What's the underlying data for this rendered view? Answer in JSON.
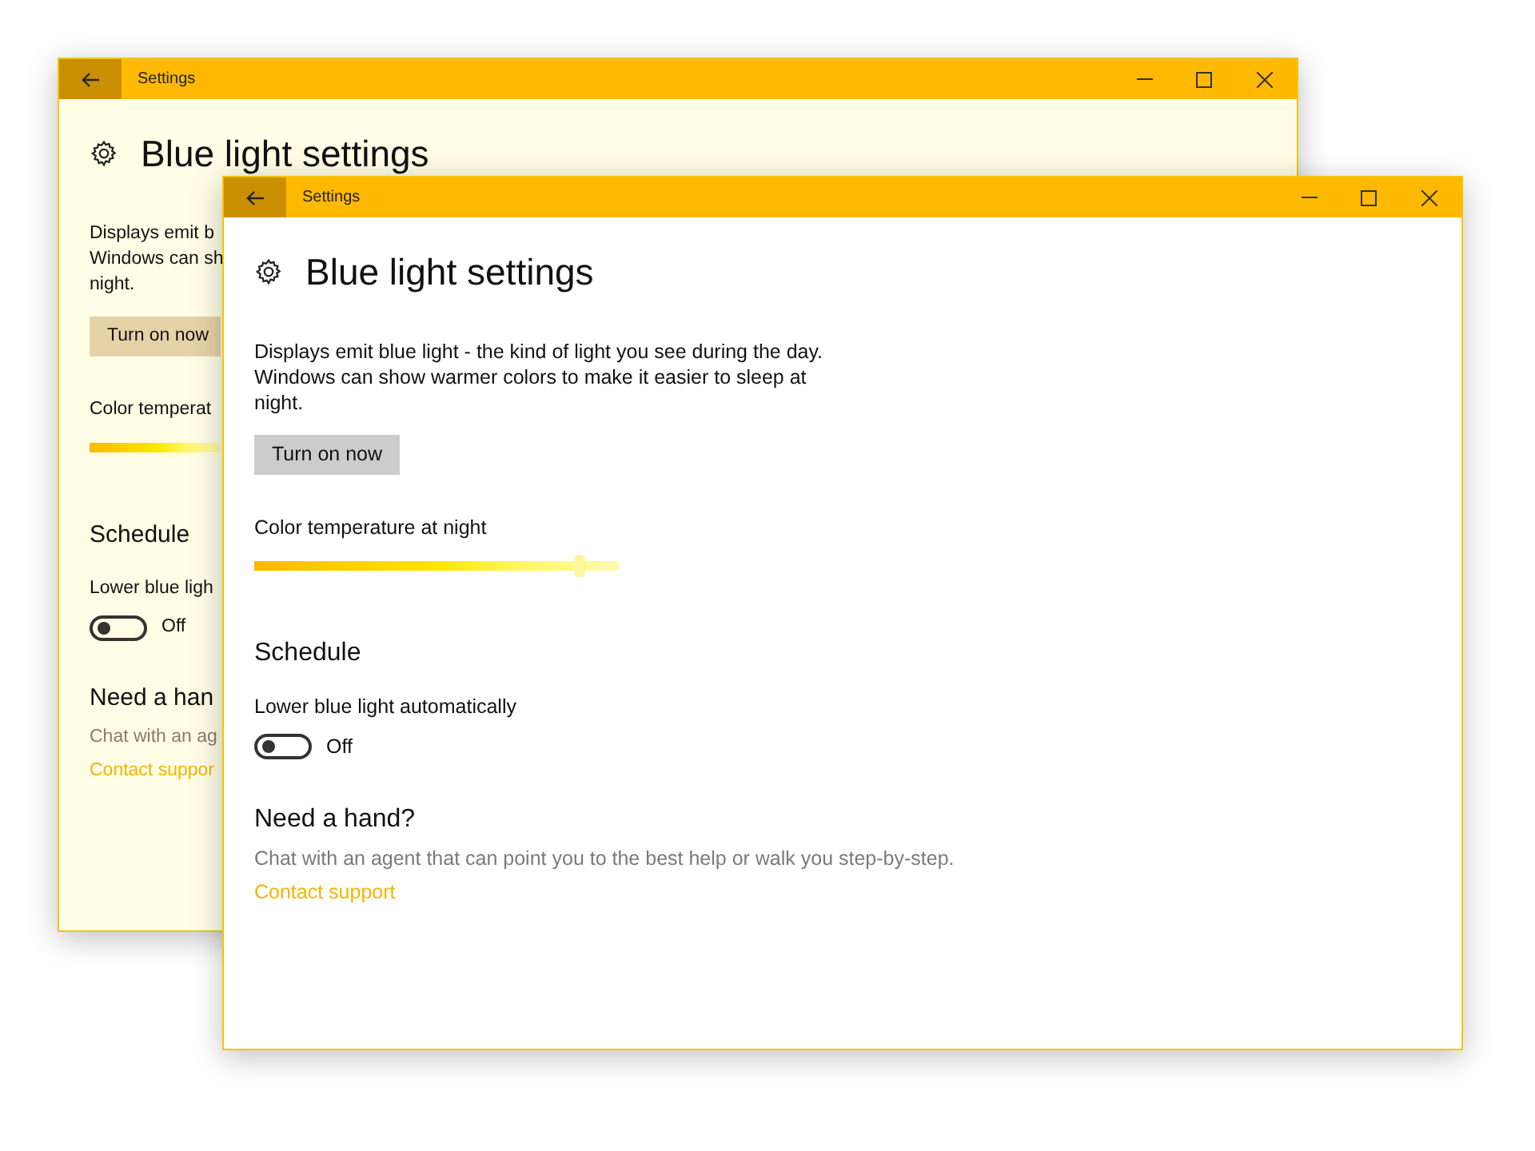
{
  "windows": [
    {
      "kind": "back",
      "title": "Settings",
      "heading": "Blue light settings",
      "description_lines": [
        "Displays emit b",
        "Windows can sh",
        "night."
      ],
      "button": "Turn on now",
      "slider": {
        "label": "Color temperat"
      },
      "schedule_heading": "Schedule",
      "toggle": {
        "label": "Lower blue ligh",
        "on": false,
        "state_text": "Off"
      },
      "help_heading": "Need a han",
      "help_text": "Chat with an ag",
      "link": "Contact suppor"
    },
    {
      "kind": "front",
      "title": "Settings",
      "heading": "Blue light settings",
      "description_lines": [
        "Displays emit blue light - the kind of light you see during the day.",
        "Windows can show warmer colors to make it easier to sleep at",
        "night."
      ],
      "button": "Turn on now",
      "slider": {
        "label": "Color temperature at night",
        "level": 0.89
      },
      "schedule_heading": "Schedule",
      "toggle": {
        "label": "Lower blue light automatically",
        "on": false,
        "state_text": "Off"
      },
      "help_heading": "Need a hand?",
      "help_text": "Chat with an agent that can point you to the best help or walk you step-by-step.",
      "link": "Contact support"
    }
  ]
}
